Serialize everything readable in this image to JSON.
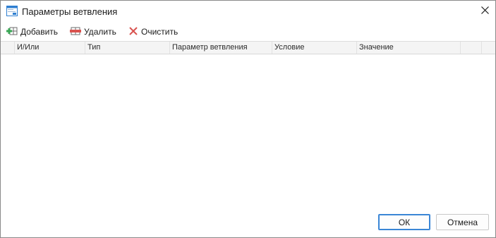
{
  "window": {
    "title": "Параметры ветвления",
    "title_icon": "window-icon",
    "close_icon": "close-icon"
  },
  "toolbar": {
    "add_label": "Добавить",
    "delete_label": "Удалить",
    "clear_label": "Очистить",
    "add_icon": "add-row-icon",
    "delete_icon": "delete-row-icon",
    "clear_icon": "clear-x-icon"
  },
  "grid": {
    "columns": [
      "",
      "И/Или",
      "Тип",
      "Параметр ветвления",
      "Условие",
      "Значение",
      "",
      ""
    ],
    "rows": []
  },
  "footer": {
    "ok_label": "ОК",
    "cancel_label": "Отмена"
  },
  "colors": {
    "accent": "#3a86d6",
    "add_green": "#3aa655",
    "delete_red": "#d9534f",
    "clear_red": "#d9534f"
  }
}
